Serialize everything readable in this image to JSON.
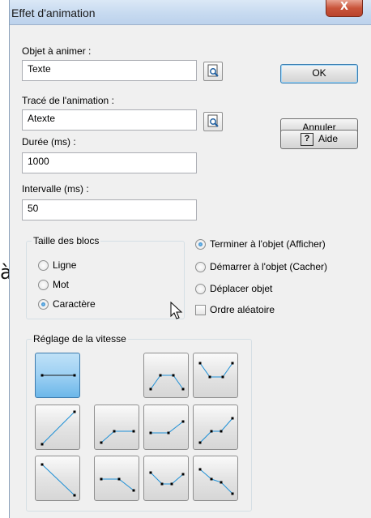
{
  "background": {
    "char": "à"
  },
  "window": {
    "title": "Effet d'animation",
    "close_icon": "X"
  },
  "form": {
    "object_label": "Objet à animer :",
    "object_value": "Texte",
    "path_label": "Tracé de l'animation :",
    "path_value": "Atexte",
    "duration_label": "Durée (ms) :",
    "duration_value": "1000",
    "interval_label": "Intervalle (ms) :",
    "interval_value": "50"
  },
  "buttons": {
    "ok": "OK",
    "cancel": "Annuler",
    "help": "Aide",
    "help_icon": "?"
  },
  "block_size": {
    "legend": "Taille des blocs",
    "options": [
      {
        "label": "Ligne",
        "selected": false
      },
      {
        "label": "Mot",
        "selected": false
      },
      {
        "label": "Caractère",
        "selected": true
      }
    ]
  },
  "end_options": {
    "options": [
      {
        "label": "Terminer à l'objet (Afficher)",
        "selected": true
      },
      {
        "label": "Démarrer à l'objet (Cacher)",
        "selected": false
      },
      {
        "label": "Déplacer objet",
        "selected": false
      }
    ],
    "random_label": "Ordre aléatoire",
    "random_checked": false
  },
  "speed": {
    "legend": "Réglage de la vitesse",
    "selected": "constant",
    "curves": [
      "constant",
      "rise-plateau-fall",
      "dip",
      "linear-rise",
      "late-flat-rise",
      "flat-then-rise",
      "rise-steps",
      "linear-fall",
      "flat-then-fall",
      "fall-middle-rise",
      "fall-steps"
    ]
  },
  "colors": {
    "selected_preset": "#9dd0f3",
    "curve_line": "#1c8fd6",
    "dot": "#000000"
  }
}
